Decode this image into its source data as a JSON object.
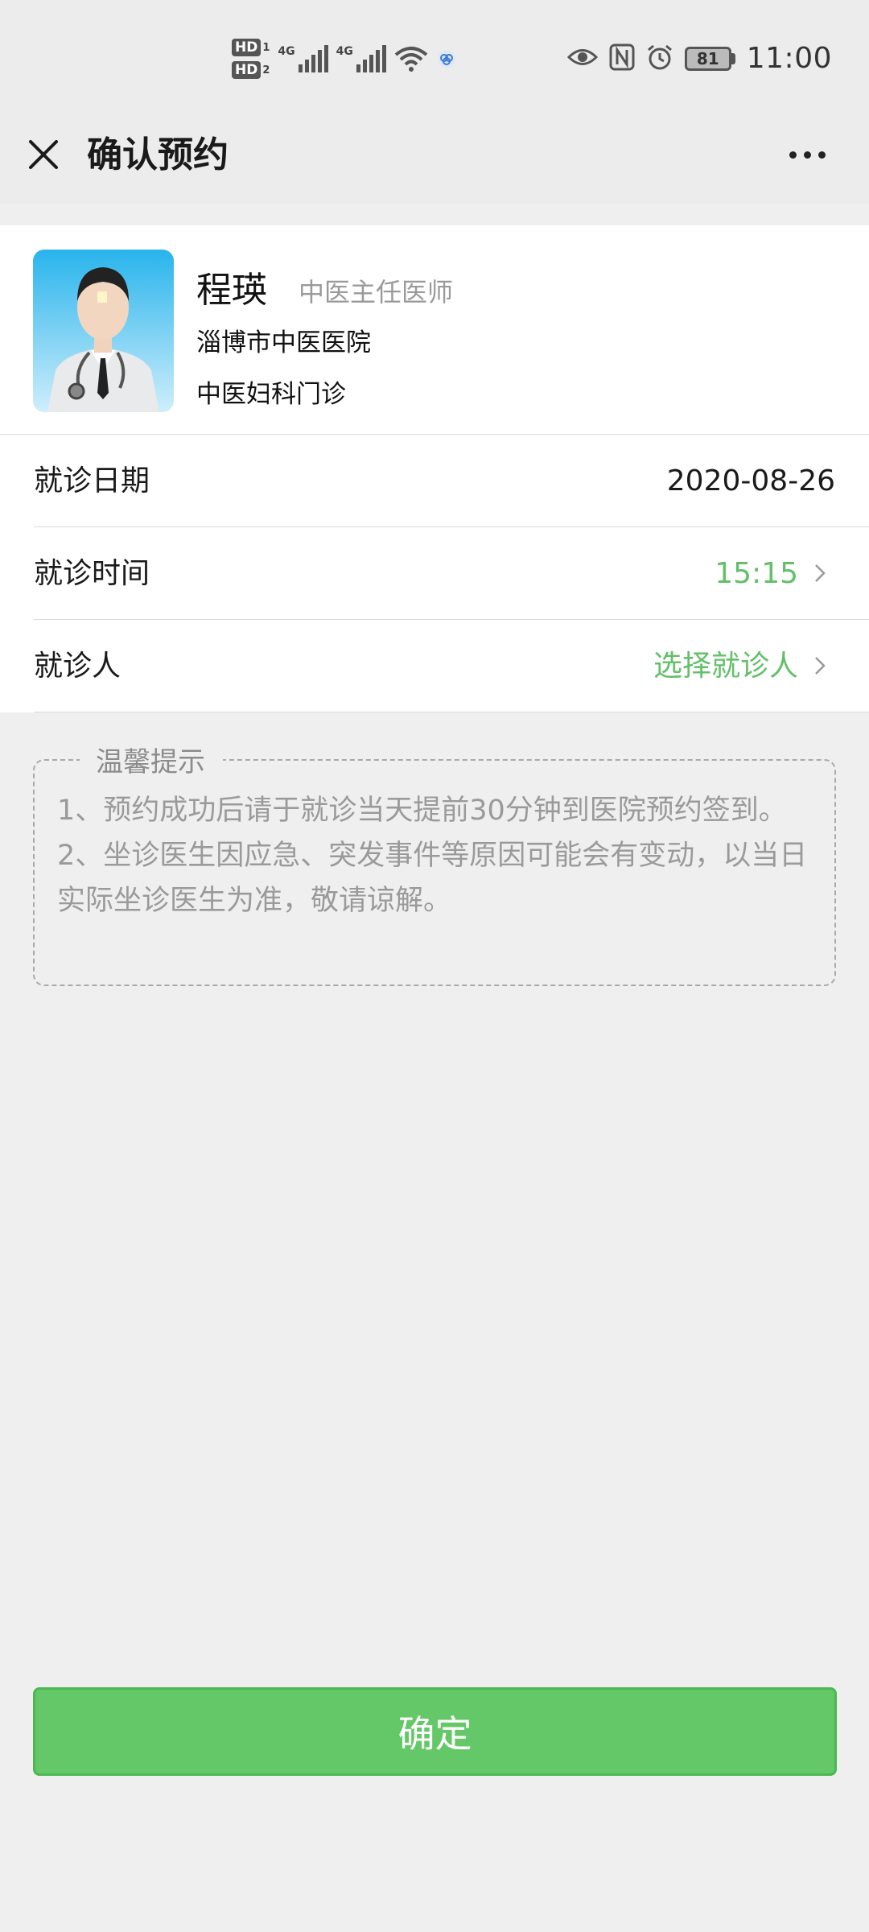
{
  "status_bar": {
    "hd1": "HD",
    "hd1_num": "1",
    "hd2": "HD",
    "hd2_num": "2",
    "net1": "4G",
    "net2": "4G",
    "battery": "81",
    "time": "11:00"
  },
  "nav": {
    "title": "确认预约"
  },
  "doctor": {
    "name": "程瑛",
    "title": "中医主任医师",
    "hospital": "淄博市中医医院",
    "department": "中医妇科门诊"
  },
  "rows": {
    "date_label": "就诊日期",
    "date_value": "2020-08-26",
    "time_label": "就诊时间",
    "time_value": "15:15",
    "patient_label": "就诊人",
    "patient_value": "选择就诊人"
  },
  "notice": {
    "title": "温馨提示",
    "line1": "1、预约成功后请于就诊当天提前30分钟到医院预约签到。",
    "line2": "2、坐诊医生因应急、突发事件等原因可能会有变动，以当日实际坐诊医生为准，敬请谅解。"
  },
  "confirm": {
    "label": "确定"
  },
  "colors": {
    "accent_green": "#62c068",
    "button_green": "#65c868",
    "background": "#efefef"
  }
}
